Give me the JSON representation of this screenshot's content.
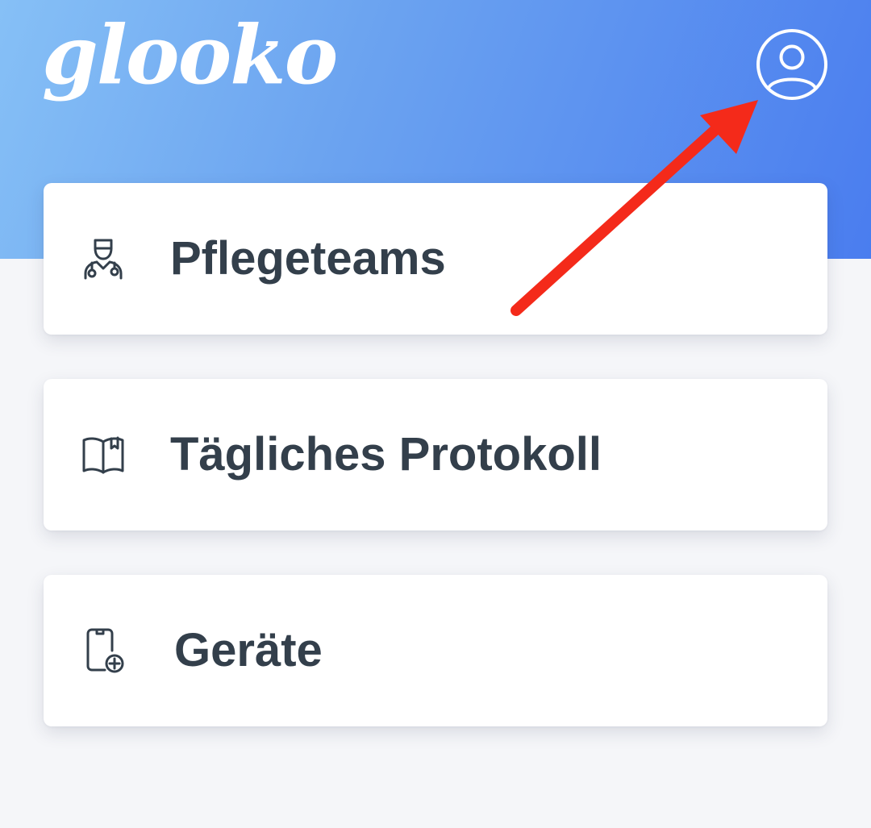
{
  "header": {
    "logo_text": "glooko",
    "profile_icon": "account-circle-icon"
  },
  "menu": {
    "items": [
      {
        "label": "Pflegeteams",
        "icon": "doctor-icon"
      },
      {
        "label": "Tägliches Protokoll",
        "icon": "book-icon"
      },
      {
        "label": "Geräte",
        "icon": "device-add-icon"
      }
    ]
  },
  "annotation": {
    "arrow_color": "#f42a1a",
    "arrow_target": "profile-button"
  },
  "colors": {
    "header_gradient_start": "#86c0f6",
    "header_gradient_end": "#4a7def",
    "text_primary": "#333f4b",
    "background": "#f5f6f9"
  }
}
